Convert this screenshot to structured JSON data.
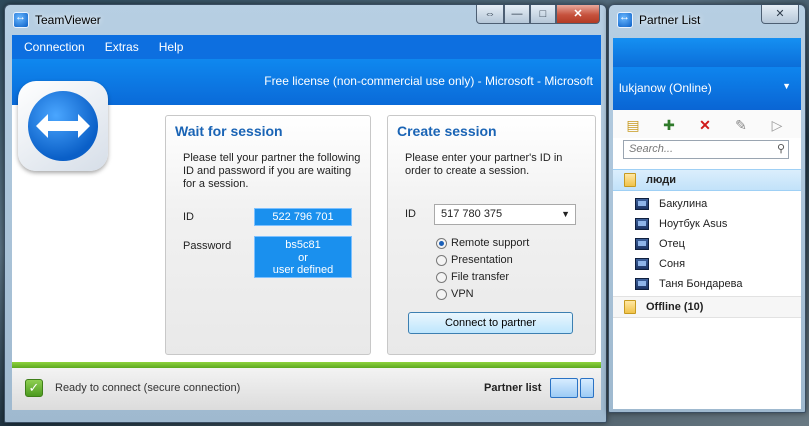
{
  "main_window": {
    "title": "TeamViewer",
    "caption_buttons": {
      "swap": "⇔",
      "minimize": "—",
      "maximize": "□",
      "close": "✕"
    },
    "menu": [
      "Connection",
      "Extras",
      "Help"
    ],
    "license_text": "Free license (non-commercial use only) - Microsoft - Microsoft"
  },
  "wait_session": {
    "title": "Wait for session",
    "description": "Please tell your partner the following ID and password if you are waiting for a session.",
    "id_label": "ID",
    "id_value": "522 796 701",
    "password_label": "Password",
    "password_lines": [
      "bs5c81",
      "or",
      "user defined"
    ]
  },
  "create_session": {
    "title": "Create session",
    "description": "Please enter your partner's ID in order to create a session.",
    "id_label": "ID",
    "partner_id_value": "517 780 375",
    "modes": [
      {
        "label": "Remote support",
        "selected": true
      },
      {
        "label": "Presentation",
        "selected": false
      },
      {
        "label": "File transfer",
        "selected": false
      },
      {
        "label": "VPN",
        "selected": false
      }
    ],
    "connect_label": "Connect to partner"
  },
  "status": {
    "text": "Ready to connect (secure connection)",
    "partner_list_label": "Partner list",
    "status_color": "#5da81f"
  },
  "partner_window": {
    "title": "Partner List",
    "close": "✕",
    "account": "lukjanow (Online)",
    "toolbar_icons": [
      "add-group-icon",
      "add-partner-icon",
      "delete-icon",
      "properties-icon",
      "connect-arrow-icon"
    ],
    "search_placeholder": "Search...",
    "groups": [
      {
        "name": "люди",
        "contacts": [
          "Бакулина",
          "Ноутбук Asus",
          "Отец",
          "Соня",
          "Таня Бондарева"
        ]
      },
      {
        "name": "Offline (10)",
        "contacts": []
      }
    ]
  },
  "colors": {
    "accent_blue": "#0d6fe0",
    "title_blue": "#1a64b5",
    "id_box_blue": "#1a90ee"
  }
}
